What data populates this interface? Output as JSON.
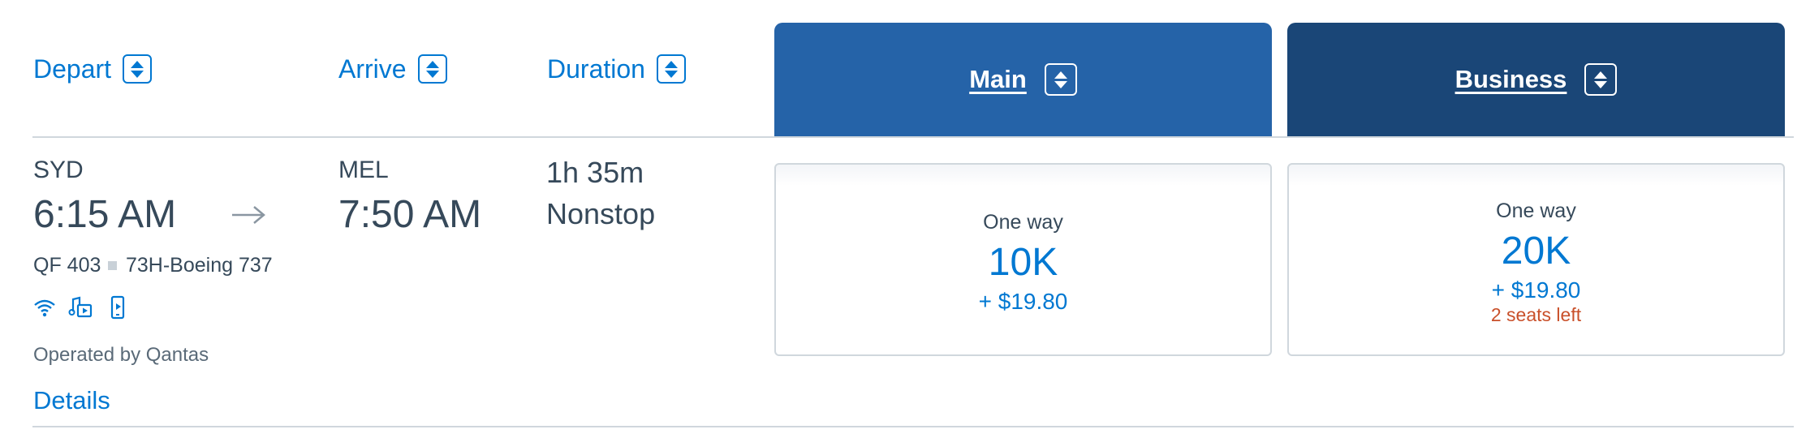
{
  "headers": {
    "depart": "Depart",
    "arrive": "Arrive",
    "duration": "Duration",
    "main": "Main",
    "business": "Business",
    "sort_icon": "sort-up-down-icon"
  },
  "flight": {
    "origin_code": "SYD",
    "depart_time": "6:15 AM",
    "dest_code": "MEL",
    "arrive_time": "7:50 AM",
    "duration": "1h 35m",
    "stops": "Nonstop",
    "flight_number": "QF 403",
    "aircraft": "73H-Boeing 737",
    "amenities": [
      "wifi-icon",
      "entertainment-icon",
      "device-streaming-icon"
    ],
    "operated_by": "Operated by Qantas",
    "details_link": "Details"
  },
  "fares": {
    "main": {
      "trip": "One way",
      "miles": "10K",
      "taxes": "+ $19.80"
    },
    "business": {
      "trip": "One way",
      "miles": "20K",
      "taxes": "+ $19.80",
      "seats_left": "2 seats left"
    }
  },
  "colors": {
    "link": "#0078d2",
    "main_header": "#2563a8",
    "business_header": "#1a4677",
    "seats_warning": "#c9502a",
    "text": "#36495a"
  }
}
